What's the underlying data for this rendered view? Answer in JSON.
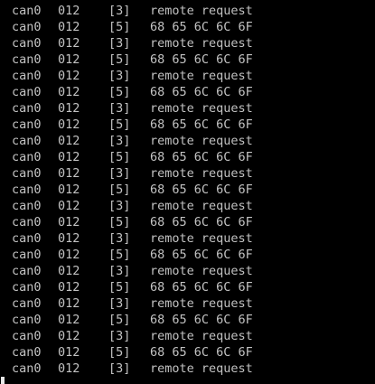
{
  "terminal": {
    "foreground_color": "#c2c2c2",
    "background_color": "#000000",
    "lines": [
      {
        "iface": "can0",
        "id": "012",
        "dlc": "[3]",
        "data": "remote request"
      },
      {
        "iface": "can0",
        "id": "012",
        "dlc": "[5]",
        "data": "68 65 6C 6C 6F"
      },
      {
        "iface": "can0",
        "id": "012",
        "dlc": "[3]",
        "data": "remote request"
      },
      {
        "iface": "can0",
        "id": "012",
        "dlc": "[5]",
        "data": "68 65 6C 6C 6F"
      },
      {
        "iface": "can0",
        "id": "012",
        "dlc": "[3]",
        "data": "remote request"
      },
      {
        "iface": "can0",
        "id": "012",
        "dlc": "[5]",
        "data": "68 65 6C 6C 6F"
      },
      {
        "iface": "can0",
        "id": "012",
        "dlc": "[3]",
        "data": "remote request"
      },
      {
        "iface": "can0",
        "id": "012",
        "dlc": "[5]",
        "data": "68 65 6C 6C 6F"
      },
      {
        "iface": "can0",
        "id": "012",
        "dlc": "[3]",
        "data": "remote request"
      },
      {
        "iface": "can0",
        "id": "012",
        "dlc": "[5]",
        "data": "68 65 6C 6C 6F"
      },
      {
        "iface": "can0",
        "id": "012",
        "dlc": "[3]",
        "data": "remote request"
      },
      {
        "iface": "can0",
        "id": "012",
        "dlc": "[5]",
        "data": "68 65 6C 6C 6F"
      },
      {
        "iface": "can0",
        "id": "012",
        "dlc": "[3]",
        "data": "remote request"
      },
      {
        "iface": "can0",
        "id": "012",
        "dlc": "[5]",
        "data": "68 65 6C 6C 6F"
      },
      {
        "iface": "can0",
        "id": "012",
        "dlc": "[3]",
        "data": "remote request"
      },
      {
        "iface": "can0",
        "id": "012",
        "dlc": "[5]",
        "data": "68 65 6C 6C 6F"
      },
      {
        "iface": "can0",
        "id": "012",
        "dlc": "[3]",
        "data": "remote request"
      },
      {
        "iface": "can0",
        "id": "012",
        "dlc": "[5]",
        "data": "68 65 6C 6C 6F"
      },
      {
        "iface": "can0",
        "id": "012",
        "dlc": "[3]",
        "data": "remote request"
      },
      {
        "iface": "can0",
        "id": "012",
        "dlc": "[5]",
        "data": "68 65 6C 6C 6F"
      },
      {
        "iface": "can0",
        "id": "012",
        "dlc": "[3]",
        "data": "remote request"
      },
      {
        "iface": "can0",
        "id": "012",
        "dlc": "[5]",
        "data": "68 65 6C 6C 6F"
      },
      {
        "iface": "can0",
        "id": "012",
        "dlc": "[3]",
        "data": "remote request"
      }
    ]
  }
}
